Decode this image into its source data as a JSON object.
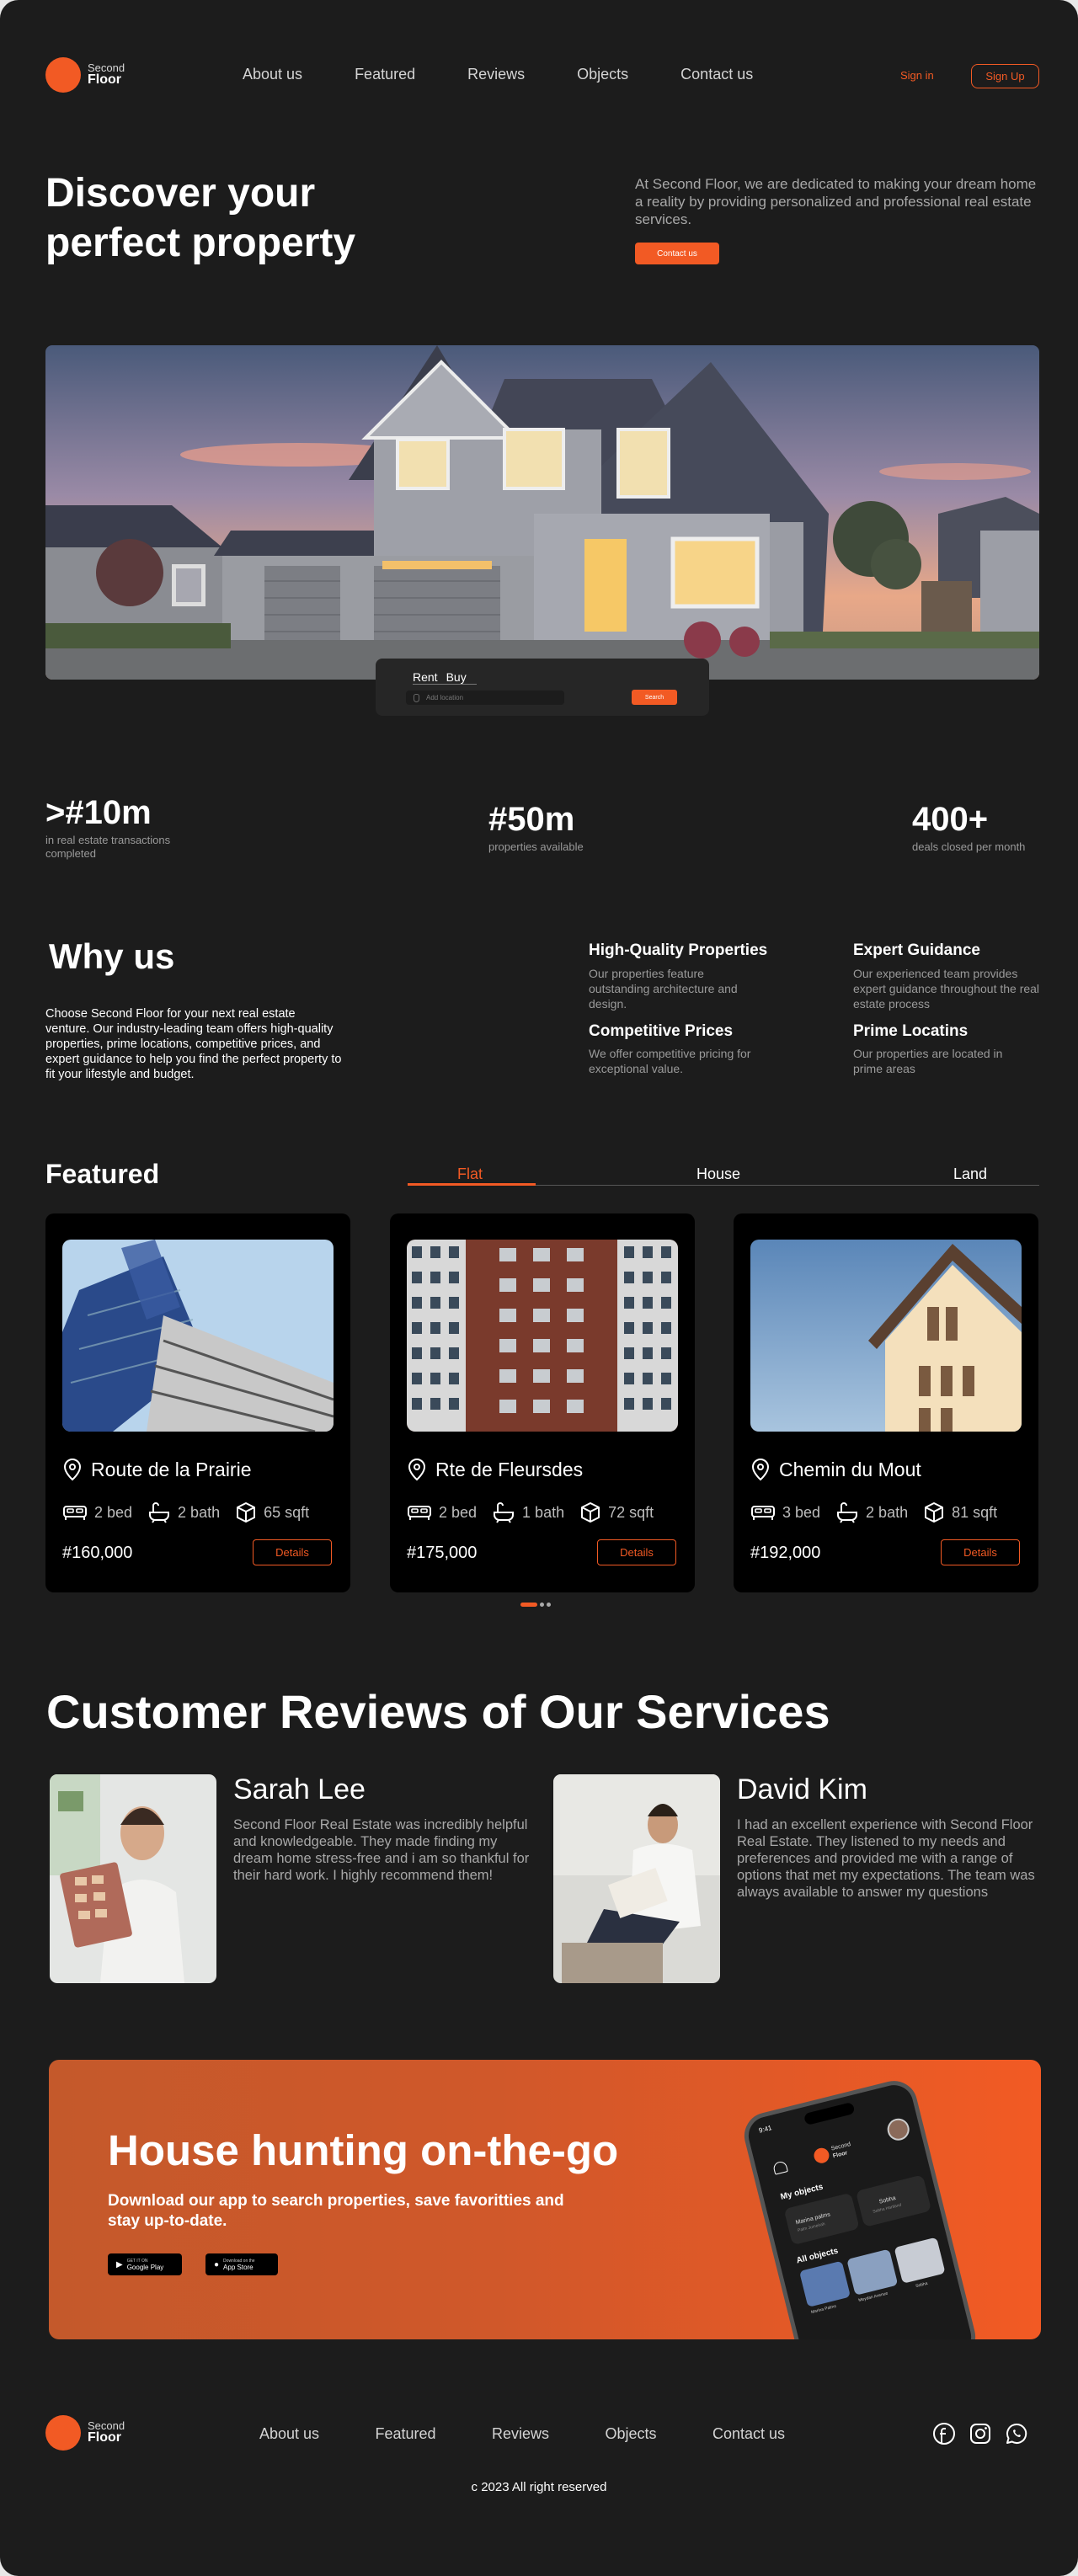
{
  "brand": {
    "line1": "Second",
    "line2": "Floor"
  },
  "nav": [
    "About us",
    "Featured",
    "Reviews",
    "Objects",
    "Contact us"
  ],
  "auth": {
    "signin": "Sign in",
    "signup": "Sign Up"
  },
  "hero": {
    "title": "Discover your perfect property",
    "description": "At Second Floor, we are dedicated to making your dream home a reality by providing personalized and professional real estate services.",
    "cta": "Contact us"
  },
  "search": {
    "tabs": [
      "Rent",
      "Buy"
    ],
    "placeholder": "Add location",
    "button": "Search"
  },
  "stats": [
    {
      "value": ">#10m",
      "label": "in real estate transactions completed"
    },
    {
      "value": "#50m",
      "label": "properties available"
    },
    {
      "value": "400+",
      "label": "deals closed per month"
    }
  ],
  "why": {
    "title": "Why us",
    "description": "Choose Second Floor for your next real estate venture. Our industry-leading team offers high-quality properties, prime locations, competitive prices, and expert guidance to help you find the perfect property to fit your lifestyle and budget.",
    "features": [
      {
        "title": "High-Quality Properties",
        "text": "Our properties feature outstanding architecture and design."
      },
      {
        "title": "Expert Guidance",
        "text": "Our experienced team provides expert guidance throughout the real estate process"
      },
      {
        "title": "Competitive Prices",
        "text": "We offer competitive pricing for exceptional value."
      },
      {
        "title": "Prime Locatins",
        "text": "Our properties are located in prime areas"
      }
    ]
  },
  "featured": {
    "title": "Featured",
    "tabs": [
      "Flat",
      "House",
      "Land"
    ],
    "active_tab": "Flat",
    "cards": [
      {
        "location": "Route de la Prairie",
        "bed": "2 bed",
        "bath": "2 bath",
        "area": "65 sqft",
        "price": "#160,000",
        "button": "Details"
      },
      {
        "location": "Rte de Fleursdes",
        "bed": "2 bed",
        "bath": "1 bath",
        "area": "72 sqft",
        "price": "#175,000",
        "button": "Details"
      },
      {
        "location": "Chemin du Mout",
        "bed": "3 bed",
        "bath": "2 bath",
        "area": "81 sqft",
        "price": "#192,000",
        "button": "Details"
      }
    ]
  },
  "reviews": {
    "title": "Customer Reviews of Our Services",
    "items": [
      {
        "name": "Sarah Lee",
        "text": "Second Floor Real Estate was incredibly helpful and knowledgeable. They made finding my dream home stress-free and i am so thankful for their hard work. I highly recommend them!"
      },
      {
        "name": "David Kim",
        "text": "I had an excellent experience with Second Floor Real Estate. They listened to my needs and preferences and provided me with a range of options that met my expectations. The team was always available to answer my questions"
      }
    ]
  },
  "promo": {
    "title": "House hunting on-the-go",
    "subtitle": "Download our app to search properties, save favoritties and stay up-to-date.",
    "google": {
      "small": "GET IT ON",
      "big": "Google Play"
    },
    "apple": {
      "small": "Download on the",
      "big": "App Store"
    },
    "phone": {
      "time": "9:41",
      "section1": "My objects",
      "obj1": "Marina palms",
      "obj1_sub": "Palm Jumeirah",
      "obj2": "Sobha",
      "obj2_sub": "Sobha Hartland",
      "section2": "All objects",
      "all1": "Marina Palms",
      "all2": "Meydan Avenue",
      "all3": "Sobha"
    }
  },
  "footer": {
    "nav": [
      "About us",
      "Featured",
      "Reviews",
      "Objects",
      "Contact us"
    ],
    "copyright": "c 2023 All right reserved"
  },
  "colors": {
    "accent": "#f25a24",
    "background": "#1c1c1c",
    "card": "#000000"
  }
}
